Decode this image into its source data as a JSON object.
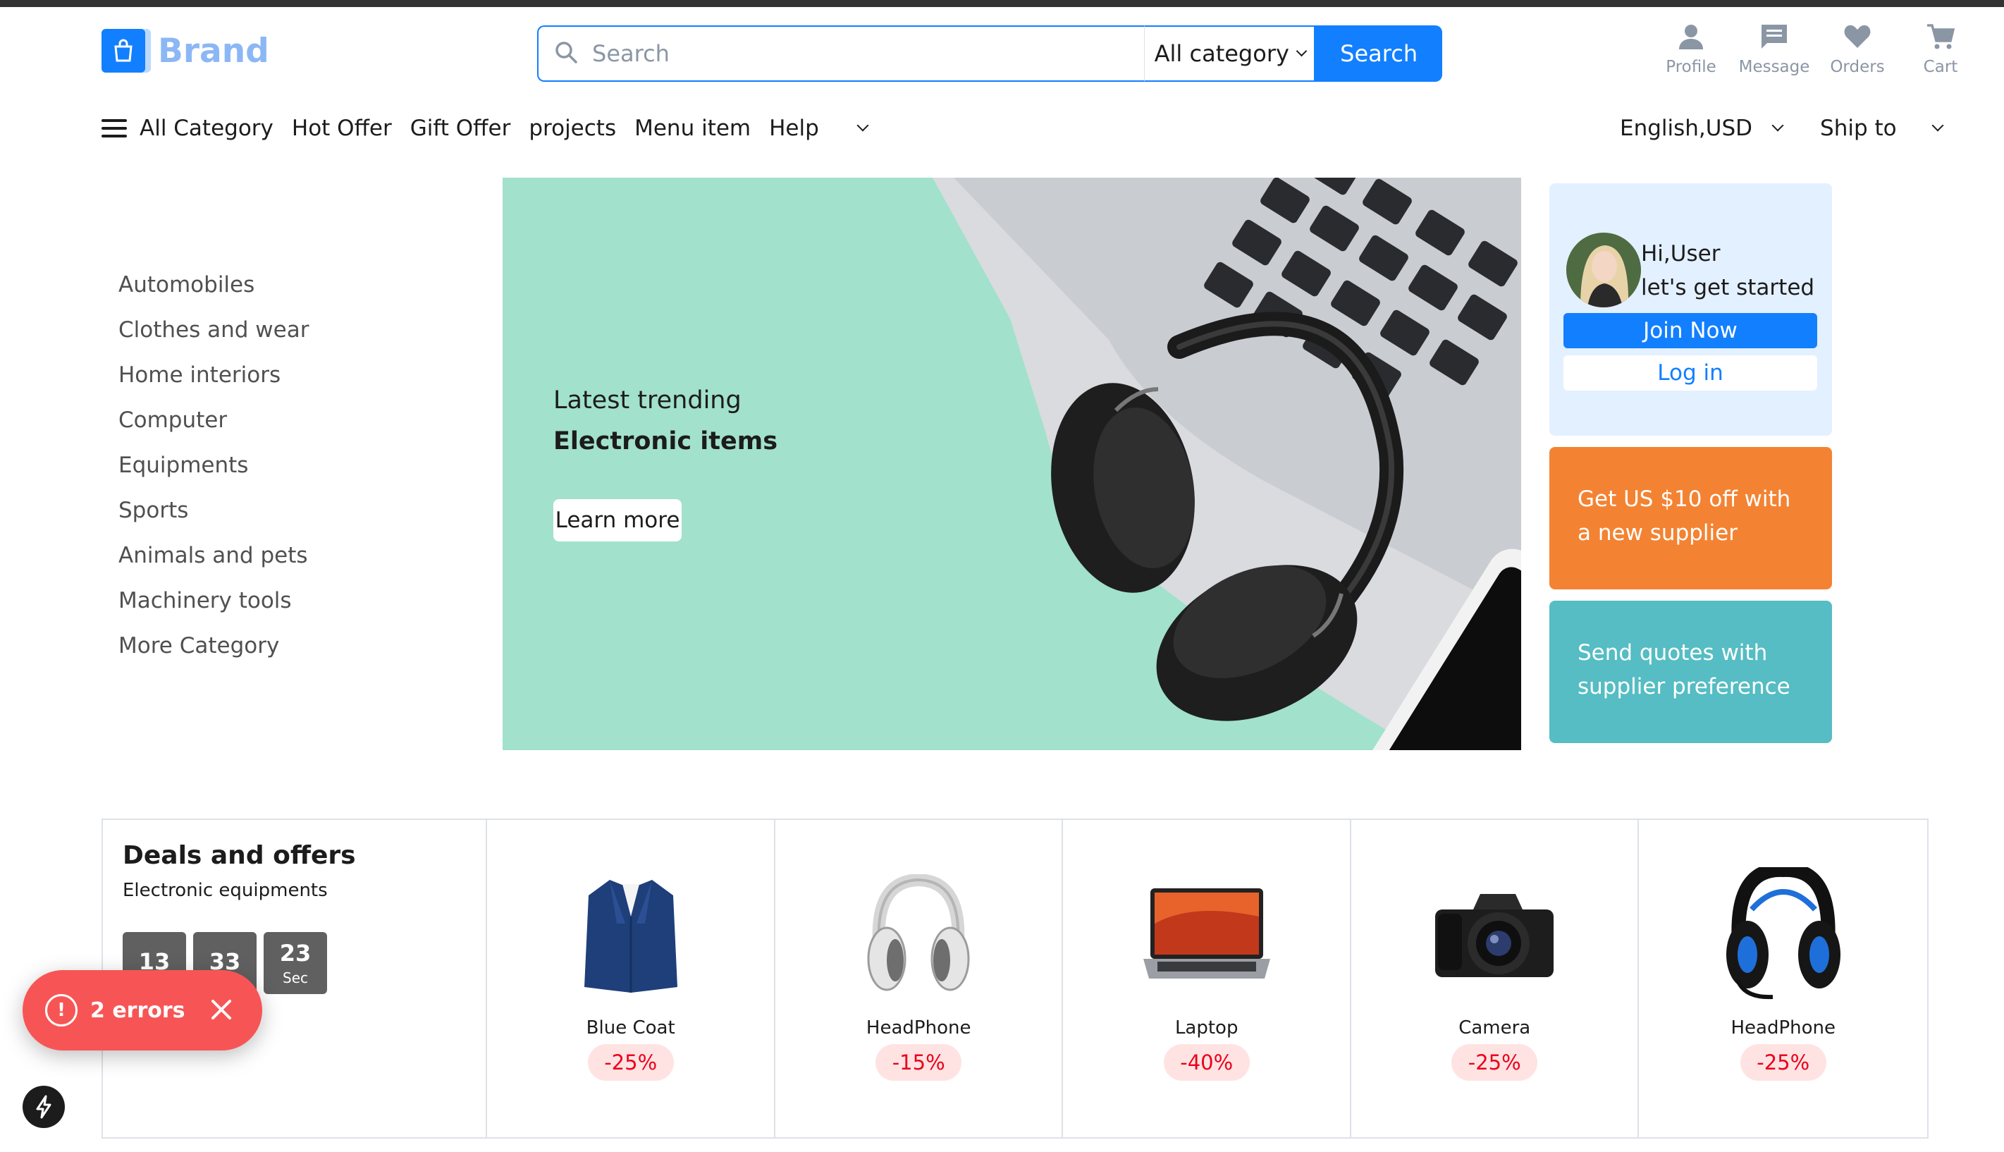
{
  "brand": {
    "name": "Brand"
  },
  "search": {
    "placeholder": "Search",
    "category": "All category",
    "button": "Search"
  },
  "actions": [
    {
      "label": "Profile",
      "icon": "person-icon"
    },
    {
      "label": "Message",
      "icon": "message-icon"
    },
    {
      "label": "Orders",
      "icon": "heart-icon"
    },
    {
      "label": "Cart",
      "icon": "cart-icon"
    }
  ],
  "nav": {
    "all_category": "All Category",
    "items": [
      "Hot Offer",
      "Gift Offer",
      "projects",
      "Menu item",
      "Help"
    ],
    "language": "English,USD",
    "ship_to": "Ship to"
  },
  "categories": [
    "Automobiles",
    "Clothes and wear",
    "Home interiors",
    "Computer",
    "Equipments",
    "Sports",
    "Animals and pets",
    "Machinery tools",
    "More Category"
  ],
  "banner": {
    "subtitle": "Latest trending",
    "title": "Electronic items",
    "button": "Learn more"
  },
  "user_card": {
    "greeting": "Hi,User",
    "message": "let's get started",
    "join": "Join Now",
    "login": "Log in"
  },
  "promos": {
    "orange": "Get US $10 off with a new supplier",
    "teal": "Send quotes with supplier preference"
  },
  "deals": {
    "title": "Deals and offers",
    "subtitle": "Electronic equipments",
    "timer": [
      {
        "value": "13",
        "label": ""
      },
      {
        "value": "33",
        "label": ""
      },
      {
        "value": "23",
        "label": "Sec"
      }
    ],
    "items": [
      {
        "name": "Blue Coat",
        "discount": "-25%"
      },
      {
        "name": "HeadPhone",
        "discount": "-15%"
      },
      {
        "name": "Laptop",
        "discount": "-40%"
      },
      {
        "name": "Camera",
        "discount": "-25%"
      },
      {
        "name": "HeadPhone",
        "discount": "-25%"
      }
    ]
  },
  "errors": {
    "text": "2 errors"
  },
  "colors": {
    "primary": "#127fff",
    "orange": "#f38332",
    "teal": "#55bdc3",
    "banner": "#a2e1cc",
    "error": "#f75555"
  }
}
